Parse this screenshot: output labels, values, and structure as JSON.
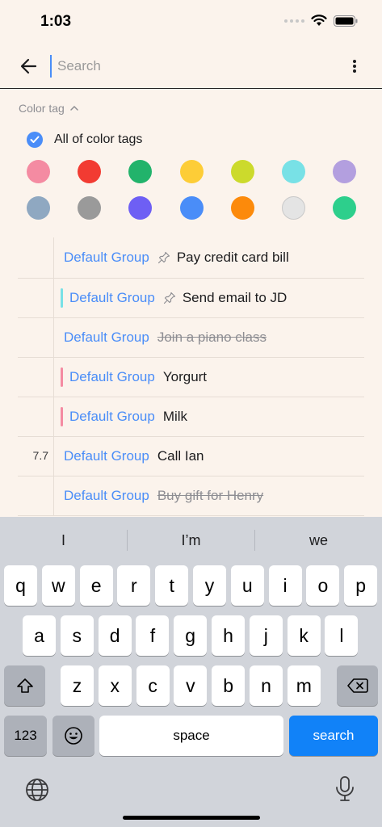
{
  "status": {
    "time": "1:03"
  },
  "search": {
    "placeholder": "Search",
    "value": ""
  },
  "color_tag": {
    "label": "Color tag",
    "all_label": "All of color tags",
    "row1": [
      "#F48BA2",
      "#F23B32",
      "#22B36B",
      "#FDCD37",
      "#CCDA2C",
      "#78E1E6",
      "#B39FDF"
    ],
    "row2": [
      "#8FA8C1",
      "#9A9A9A",
      "#6E5FF4",
      "#4A8DF8",
      "#FC8A0B",
      "#E4E4E4",
      "#2DCF8C"
    ]
  },
  "tasks": [
    {
      "date": "",
      "bar": "",
      "group": "Default Group",
      "pin": true,
      "title": "Pay credit card bill",
      "done": false
    },
    {
      "date": "",
      "bar": "#78E1E6",
      "group": "Default Group",
      "pin": true,
      "title": "Send email to JD",
      "done": false
    },
    {
      "date": "",
      "bar": "",
      "group": "Default Group",
      "pin": false,
      "title": "Join a piano class",
      "done": true
    },
    {
      "date": "",
      "bar": "#F48BA2",
      "group": "Default Group",
      "pin": false,
      "title": "Yorgurt",
      "done": false
    },
    {
      "date": "",
      "bar": "#F48BA2",
      "group": "Default Group",
      "pin": false,
      "title": "Milk",
      "done": false
    },
    {
      "date": "7.7",
      "bar": "",
      "group": "Default Group",
      "pin": false,
      "title": "Call Ian",
      "done": false
    },
    {
      "date": "",
      "bar": "",
      "group": "Default Group",
      "pin": false,
      "title": "Buy gift for Henry",
      "done": true
    }
  ],
  "keyboard": {
    "suggestions": [
      "I",
      "I’m",
      "we"
    ],
    "row1": [
      "q",
      "w",
      "e",
      "r",
      "t",
      "y",
      "u",
      "i",
      "o",
      "p"
    ],
    "row2": [
      "a",
      "s",
      "d",
      "f",
      "g",
      "h",
      "j",
      "k",
      "l"
    ],
    "row3": [
      "z",
      "x",
      "c",
      "v",
      "b",
      "n",
      "m"
    ],
    "numbers_label": "123",
    "space_label": "space",
    "search_label": "search"
  }
}
